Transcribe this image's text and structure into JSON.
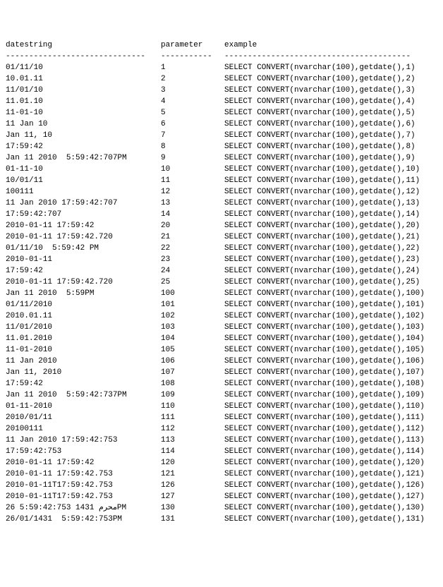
{
  "headers": {
    "c1": "datestring",
    "c2": "parameter",
    "c3": "example"
  },
  "separators": {
    "c1": "------------------------------",
    "c2": "-----------",
    "c3": "----------------------------------------"
  },
  "rows": [
    {
      "c1": "01/11/10",
      "c2": "1",
      "c3": "SELECT CONVERT(nvarchar(100),getdate(),1)"
    },
    {
      "c1": "10.01.11",
      "c2": "2",
      "c3": "SELECT CONVERT(nvarchar(100),getdate(),2)"
    },
    {
      "c1": "11/01/10",
      "c2": "3",
      "c3": "SELECT CONVERT(nvarchar(100),getdate(),3)"
    },
    {
      "c1": "11.01.10",
      "c2": "4",
      "c3": "SELECT CONVERT(nvarchar(100),getdate(),4)"
    },
    {
      "c1": "11-01-10",
      "c2": "5",
      "c3": "SELECT CONVERT(nvarchar(100),getdate(),5)"
    },
    {
      "c1": "11 Jan 10",
      "c2": "6",
      "c3": "SELECT CONVERT(nvarchar(100),getdate(),6)"
    },
    {
      "c1": "Jan 11, 10",
      "c2": "7",
      "c3": "SELECT CONVERT(nvarchar(100),getdate(),7)"
    },
    {
      "c1": "17:59:42",
      "c2": "8",
      "c3": "SELECT CONVERT(nvarchar(100),getdate(),8)"
    },
    {
      "c1": "Jan 11 2010  5:59:42:707PM",
      "c2": "9",
      "c3": "SELECT CONVERT(nvarchar(100),getdate(),9)"
    },
    {
      "c1": "01-11-10",
      "c2": "10",
      "c3": "SELECT CONVERT(nvarchar(100),getdate(),10)"
    },
    {
      "c1": "10/01/11",
      "c2": "11",
      "c3": "SELECT CONVERT(nvarchar(100),getdate(),11)"
    },
    {
      "c1": "100111",
      "c2": "12",
      "c3": "SELECT CONVERT(nvarchar(100),getdate(),12)"
    },
    {
      "c1": "11 Jan 2010 17:59:42:707",
      "c2": "13",
      "c3": "SELECT CONVERT(nvarchar(100),getdate(),13)"
    },
    {
      "c1": "17:59:42:707",
      "c2": "14",
      "c3": "SELECT CONVERT(nvarchar(100),getdate(),14)"
    },
    {
      "c1": "2010-01-11 17:59:42",
      "c2": "20",
      "c3": "SELECT CONVERT(nvarchar(100),getdate(),20)"
    },
    {
      "c1": "2010-01-11 17:59:42.720",
      "c2": "21",
      "c3": "SELECT CONVERT(nvarchar(100),getdate(),21)"
    },
    {
      "c1": "01/11/10  5:59:42 PM",
      "c2": "22",
      "c3": "SELECT CONVERT(nvarchar(100),getdate(),22)"
    },
    {
      "c1": "2010-01-11",
      "c2": "23",
      "c3": "SELECT CONVERT(nvarchar(100),getdate(),23)"
    },
    {
      "c1": "17:59:42",
      "c2": "24",
      "c3": "SELECT CONVERT(nvarchar(100),getdate(),24)"
    },
    {
      "c1": "2010-01-11 17:59:42.720",
      "c2": "25",
      "c3": "SELECT CONVERT(nvarchar(100),getdate(),25)"
    },
    {
      "c1": "Jan 11 2010  5:59PM",
      "c2": "100",
      "c3": "SELECT CONVERT(nvarchar(100),getdate(),100)"
    },
    {
      "c1": "01/11/2010",
      "c2": "101",
      "c3": "SELECT CONVERT(nvarchar(100),getdate(),101)"
    },
    {
      "c1": "2010.01.11",
      "c2": "102",
      "c3": "SELECT CONVERT(nvarchar(100),getdate(),102)"
    },
    {
      "c1": "11/01/2010",
      "c2": "103",
      "c3": "SELECT CONVERT(nvarchar(100),getdate(),103)"
    },
    {
      "c1": "11.01.2010",
      "c2": "104",
      "c3": "SELECT CONVERT(nvarchar(100),getdate(),104)"
    },
    {
      "c1": "11-01-2010",
      "c2": "105",
      "c3": "SELECT CONVERT(nvarchar(100),getdate(),105)"
    },
    {
      "c1": "11 Jan 2010",
      "c2": "106",
      "c3": "SELECT CONVERT(nvarchar(100),getdate(),106)"
    },
    {
      "c1": "Jan 11, 2010",
      "c2": "107",
      "c3": "SELECT CONVERT(nvarchar(100),getdate(),107)"
    },
    {
      "c1": "17:59:42",
      "c2": "108",
      "c3": "SELECT CONVERT(nvarchar(100),getdate(),108)"
    },
    {
      "c1": "Jan 11 2010  5:59:42:737PM",
      "c2": "109",
      "c3": "SELECT CONVERT(nvarchar(100),getdate(),109)"
    },
    {
      "c1": "01-11-2010",
      "c2": "110",
      "c3": "SELECT CONVERT(nvarchar(100),getdate(),110)"
    },
    {
      "c1": "2010/01/11",
      "c2": "111",
      "c3": "SELECT CONVERT(nvarchar(100),getdate(),111)"
    },
    {
      "c1": "20100111",
      "c2": "112",
      "c3": "SELECT CONVERT(nvarchar(100),getdate(),112)"
    },
    {
      "c1": "11 Jan 2010 17:59:42:753",
      "c2": "113",
      "c3": "SELECT CONVERT(nvarchar(100),getdate(),113)"
    },
    {
      "c1": "17:59:42:753",
      "c2": "114",
      "c3": "SELECT CONVERT(nvarchar(100),getdate(),114)"
    },
    {
      "c1": "2010-01-11 17:59:42",
      "c2": "120",
      "c3": "SELECT CONVERT(nvarchar(100),getdate(),120)"
    },
    {
      "c1": "2010-01-11 17:59:42.753",
      "c2": "121",
      "c3": "SELECT CONVERT(nvarchar(100),getdate(),121)"
    },
    {
      "c1": "2010-01-11T17:59:42.753",
      "c2": "126",
      "c3": "SELECT CONVERT(nvarchar(100),getdate(),126)"
    },
    {
      "c1": "2010-01-11T17:59:42.753",
      "c2": "127",
      "c3": "SELECT CONVERT(nvarchar(100),getdate(),127)"
    },
    {
      "c1": "26 5:59:42:753 1431 محرمPM",
      "c2": "130",
      "c3": "SELECT CONVERT(nvarchar(100),getdate(),130)"
    },
    {
      "c1": "26/01/1431  5:59:42:753PM",
      "c2": "131",
      "c3": "SELECT CONVERT(nvarchar(100),getdate(),131)"
    }
  ]
}
